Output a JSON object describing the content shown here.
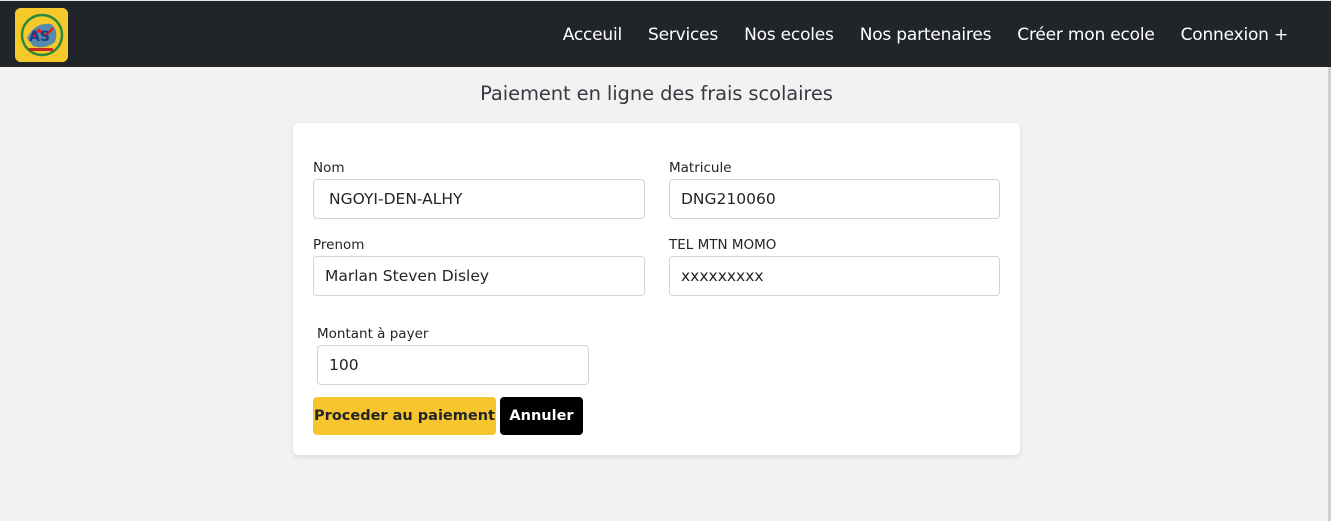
{
  "nav": {
    "links": [
      "Acceuil",
      "Services",
      "Nos ecoles",
      "Nos partenaires",
      "Créer mon ecole",
      "Connexion +"
    ]
  },
  "page": {
    "title": "Paiement en ligne des frais scolaires"
  },
  "form": {
    "nom": {
      "label": "Nom",
      "value": "NGOYI-DEN-ALHY"
    },
    "matricule": {
      "label": "Matricule",
      "value": "DNG210060"
    },
    "prenom": {
      "label": "Prenom",
      "value": "Marlan Steven Disley"
    },
    "tel": {
      "label": "TEL MTN MOMO",
      "value": "xxxxxxxxx"
    },
    "montant": {
      "label": "Montant à payer",
      "value": "100"
    },
    "pay_button": "Proceder au paiement",
    "cancel_button": "Annuler"
  },
  "colors": {
    "navbar": "#212529",
    "accent": "#f7c52d",
    "background": "#f2f2f2"
  }
}
